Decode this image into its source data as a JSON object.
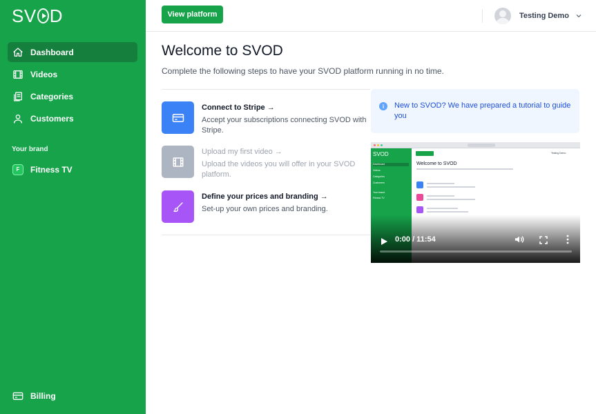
{
  "sidebar": {
    "logo": {
      "left": "SV",
      "right": "D"
    },
    "nav": [
      {
        "label": "Dashboard",
        "icon": "home-icon",
        "active": true
      },
      {
        "label": "Videos",
        "icon": "film-icon",
        "active": false
      },
      {
        "label": "Categories",
        "icon": "collection-icon",
        "active": false
      },
      {
        "label": "Customers",
        "icon": "user-icon",
        "active": false
      }
    ],
    "brand_heading": "Your brand",
    "brand": {
      "badge": "F",
      "label": "Fitness TV"
    },
    "billing": {
      "label": "Billing",
      "icon": "credit-card-icon"
    }
  },
  "header": {
    "view_platform": "View platform",
    "user_name": "Testing Demo"
  },
  "main": {
    "title": "Welcome to SVOD",
    "subtitle": "Complete the following steps to have your SVOD platform running in no time.",
    "steps": [
      {
        "title": "Connect to Stripe →",
        "desc": "Accept your subscriptions connecting SVOD with Stripe.",
        "color": "#3b82f6",
        "icon": "credit-card-icon",
        "enabled": true
      },
      {
        "title": "Upload my first video →",
        "desc": "Upload the videos you will offer in your SVOD platform.",
        "color": "#adb5c2",
        "icon": "film-icon",
        "enabled": false
      },
      {
        "title": "Define your prices and branding →",
        "desc": "Set-up your own prices and branding.",
        "color": "#a855f7",
        "icon": "brush-icon",
        "enabled": true
      }
    ],
    "info": {
      "icon": "info-icon",
      "text": "New to SVOD? We have prepared a tutorial to guide you"
    },
    "video": {
      "time": "0:00 / 11:54",
      "progress": 0,
      "thumb": {
        "logo": "SVOD",
        "title": "Welcome to SVOD",
        "nav": [
          "Dashboard",
          "Videos",
          "Categories",
          "Customers"
        ],
        "brand_heading": "Your brand",
        "brand": "Fitness TV",
        "user": "Testing Demo"
      }
    }
  },
  "colors": {
    "sidebar": "#16a34a",
    "active": "#15803d",
    "info_bg": "#eff6ff",
    "info_text": "#1d4ed8"
  }
}
